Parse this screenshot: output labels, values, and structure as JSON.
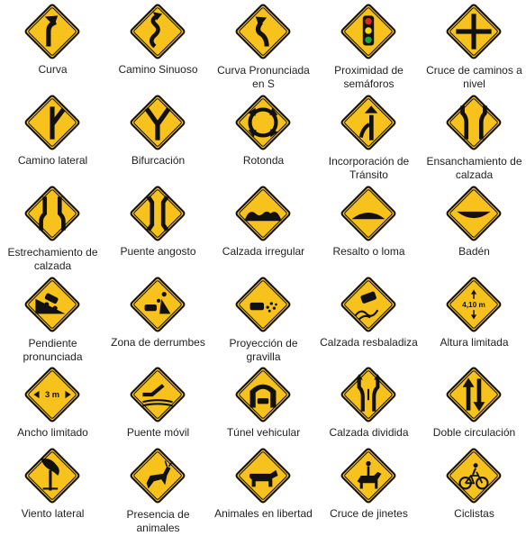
{
  "colors": {
    "sign_fill": "#F7C21B",
    "sign_border": "#111111",
    "symbol": "#111111",
    "red": "#E4271B",
    "yellow": "#F5D90A",
    "green": "#1FA33B"
  },
  "signs": [
    {
      "label": "Curva",
      "icon": "curve-arrow-icon"
    },
    {
      "label": "Camino Sinuoso",
      "icon": "winding-road-icon"
    },
    {
      "label": "Curva Pronunciada\nen S",
      "icon": "s-curve-icon"
    },
    {
      "label": "Proximidad de\nsemáforos",
      "icon": "traffic-light-icon"
    },
    {
      "label": "Cruce de caminos a\nnivel",
      "icon": "crossroad-icon"
    },
    {
      "label": "Camino lateral",
      "icon": "side-road-icon"
    },
    {
      "label": "Bifurcación",
      "icon": "fork-icon"
    },
    {
      "label": "Rotonda",
      "icon": "roundabout-icon"
    },
    {
      "label": "Incorporación de\nTránsito",
      "icon": "merge-icon"
    },
    {
      "label": "Ensanchamiento de\ncalzada",
      "icon": "road-widens-icon"
    },
    {
      "label": "Estrechamiento de\ncalzada",
      "icon": "road-narrows-icon"
    },
    {
      "label": "Puente angosto",
      "icon": "narrow-bridge-icon"
    },
    {
      "label": "Calzada irregular",
      "icon": "bumpy-road-icon"
    },
    {
      "label": "Resalto o loma",
      "icon": "speed-bump-icon"
    },
    {
      "label": "Badén",
      "icon": "dip-icon"
    },
    {
      "label": "Pendiente\npronunciada",
      "icon": "steep-slope-icon"
    },
    {
      "label": "Zona de derrumbes",
      "icon": "falling-rocks-icon"
    },
    {
      "label": "Proyección de\ngravilla",
      "icon": "loose-gravel-icon"
    },
    {
      "label": "Calzada resbaladiza",
      "icon": "slippery-road-icon"
    },
    {
      "label": "Altura limitada",
      "icon": "height-limit-icon",
      "sign_text": "4,10 m"
    },
    {
      "label": "Ancho limitado",
      "icon": "width-limit-icon",
      "sign_text": "3 m"
    },
    {
      "label": "Puente móvil",
      "icon": "drawbridge-icon"
    },
    {
      "label": "Túnel vehicular",
      "icon": "tunnel-icon"
    },
    {
      "label": "Calzada dividida",
      "icon": "divided-road-icon"
    },
    {
      "label": "Doble circulación",
      "icon": "two-way-traffic-icon"
    },
    {
      "label": "Viento lateral",
      "icon": "crosswind-icon"
    },
    {
      "label": "Presencia de\nanimales",
      "icon": "deer-crossing-icon"
    },
    {
      "label": "Animales en libertad",
      "icon": "cattle-crossing-icon"
    },
    {
      "label": "Cruce de jinetes",
      "icon": "horse-rider-icon"
    },
    {
      "label": "Ciclistas",
      "icon": "bicycle-icon"
    }
  ]
}
